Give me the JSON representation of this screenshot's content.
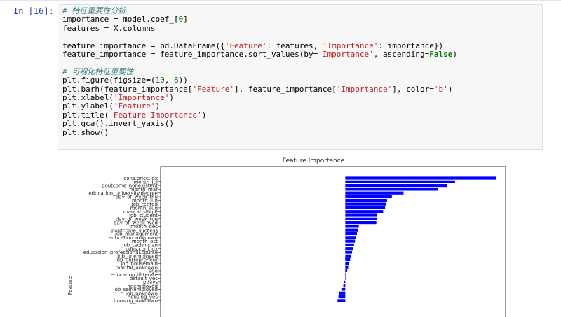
{
  "cell": {
    "prompt": "In [16]:",
    "lines": [
      "# 特征重要性分析",
      "importance = model.coef_[0]",
      "features = X.columns",
      "",
      "feature_importance = pd.DataFrame({'Feature': features, 'Importance': importance})",
      "feature_importance = feature_importance.sort_values(by='Importance', ascending=False)",
      "",
      "# 可视化特征重要性",
      "plt.figure(figsize=(10, 8))",
      "plt.barh(feature_importance['Feature'], feature_importance['Importance'], color='b')",
      "plt.xlabel('Importance')",
      "plt.ylabel('Feature')",
      "plt.title('Feature Importance')",
      "plt.gca().invert_yaxis()",
      "plt.show()"
    ]
  },
  "chart_data": {
    "type": "bar",
    "orientation": "horizontal",
    "title": "Feature Importance",
    "xlabel": "",
    "ylabel": "Feature",
    "bar_color": "#0000ff",
    "xlim": [
      -1.9,
      1.65
    ],
    "categories": [
      "cons.price.idx",
      "month_jul",
      "poutcome_nonexistent",
      "month_mar",
      "education_university.degree",
      "day_of_week_thu",
      "month_jun",
      "job_retired",
      "month_aug",
      "marital_single",
      "job_student",
      "day_of_week_tue",
      "day_of_week_wed",
      "month_dec",
      "poutcome_success",
      "job_management",
      "education_unknown",
      "month_oct",
      "job_technician",
      "cons.conf.idx",
      "education_professional.course",
      "job_unemployed",
      "job_entrepreneur",
      "job_housemaid",
      "marital_unknown",
      "age",
      "education_illiterate",
      "default_yes",
      "pdays",
      "nr.employed",
      "job_self-employed",
      "job_unknown",
      "housing_yes",
      "housing_unknown"
    ],
    "values": [
      1.55,
      1.13,
      1.05,
      0.95,
      0.6,
      0.48,
      0.43,
      0.42,
      0.41,
      0.39,
      0.33,
      0.33,
      0.32,
      0.14,
      0.13,
      0.12,
      0.11,
      0.1,
      0.09,
      0.08,
      0.07,
      0.06,
      0.05,
      0.04,
      0.03,
      0.02,
      0.01,
      0.0,
      -0.01,
      -0.02,
      -0.04,
      -0.06,
      -0.07,
      -0.08
    ]
  }
}
